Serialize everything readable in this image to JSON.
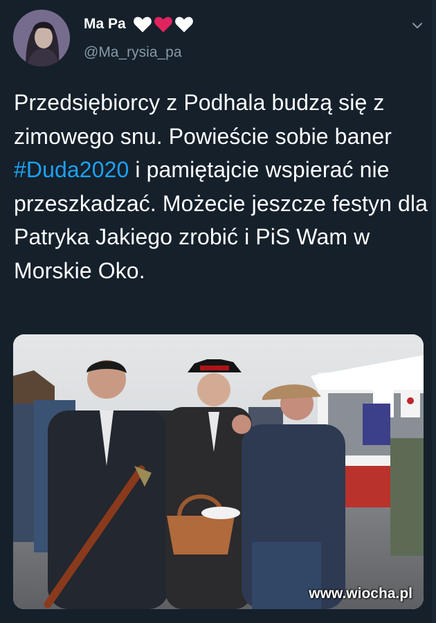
{
  "tweet": {
    "display_name": "Ma Pa",
    "handle": "@Ma_rysia_pa",
    "text_before": "Przedsiębiorcy z Podhala budzą się z zimowego snu. Powieście sobie baner ",
    "hashtag": "#Duda2020",
    "text_after": " i pamiętajcie wspierać nie przeszkadzać. Możecie jeszcze festyn dla Patryka Jakiego zrobić i PiS Wam w Morskie Oko.",
    "name_emoji": [
      "white-heart",
      "red-heart",
      "white-heart"
    ]
  },
  "media": {
    "watermark": "www.wiocha.pl"
  },
  "icons": {
    "more": "chevron-down-icon"
  },
  "colors": {
    "background": "#15202b",
    "text": "#ffffff",
    "secondary": "#8899a6",
    "link": "#1da1f2",
    "heart_red": "#e0245e"
  }
}
